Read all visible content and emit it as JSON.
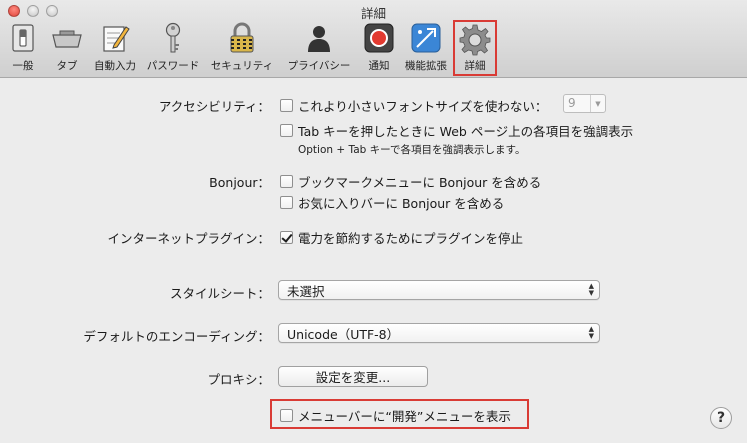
{
  "window": {
    "title": "詳細"
  },
  "toolbar": {
    "items": [
      {
        "label": "一般",
        "icon": "general-switch-icon"
      },
      {
        "label": "タブ",
        "icon": "tabs-icon"
      },
      {
        "label": "自動入力",
        "icon": "autofill-pencil-icon"
      },
      {
        "label": "パスワード",
        "icon": "key-icon"
      },
      {
        "label": "セキュリティ",
        "icon": "lock-icon"
      },
      {
        "label": "プライバシー",
        "icon": "person-silhouette-icon"
      },
      {
        "label": "通知",
        "icon": "notification-record-icon"
      },
      {
        "label": "機能拡張",
        "icon": "extensions-puzzle-icon"
      },
      {
        "label": "詳細",
        "icon": "gear-icon",
        "selected": true
      }
    ]
  },
  "accessibility": {
    "label": "アクセシビリティ：",
    "min_font_option": "これより小さいフォントサイズを使わない：",
    "min_font_value": "9",
    "tab_highlight_option": "Tab キーを押したときに Web ページ上の各項目を強調表示",
    "tab_highlight_note": "Option + Tab キーで各項目を強調表示します。"
  },
  "bonjour": {
    "label": "Bonjour：",
    "bookmarks_menu_option": "ブックマークメニューに Bonjour を含める",
    "favorites_bar_option": "お気に入りバーに Bonjour を含める"
  },
  "plugins": {
    "label": "インターネットプラグイン：",
    "power_saver_option": "電力を節約するためにプラグインを停止"
  },
  "stylesheet": {
    "label": "スタイルシート：",
    "value": "未選択"
  },
  "encoding": {
    "label": "デフォルトのエンコーディング：",
    "value": "Unicode（UTF-8）"
  },
  "proxy": {
    "label": "プロキシ：",
    "button": "設定を変更..."
  },
  "develop_menu": {
    "option": "メニューバーに“開発”メニューを表示"
  },
  "help": {
    "label": "?"
  },
  "colors": {
    "highlight": "#d93b35",
    "background": "#ececec"
  }
}
